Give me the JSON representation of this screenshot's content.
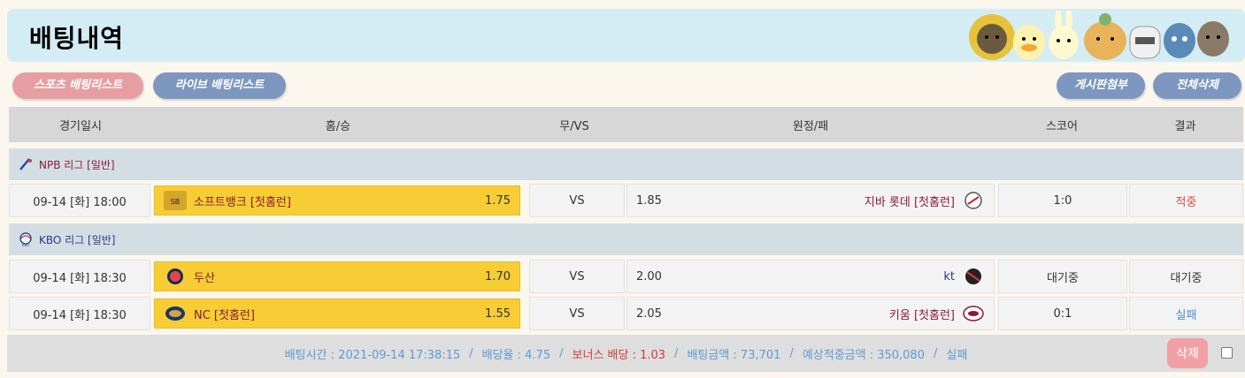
{
  "header": {
    "title": "배팅내역"
  },
  "buttons": {
    "sports_list": "스포츠 배팅리스트",
    "live_list": "라이브 배팅리스트",
    "board_attach": "게시판첨부",
    "delete_all": "전체삭제"
  },
  "table": {
    "columns": [
      "경기일시",
      "홈/승",
      "무/VS",
      "원정/패",
      "스코어",
      "결과"
    ],
    "groups": [
      {
        "league": "NPB 리그 [일반]",
        "league_icon": "npb-logo-icon",
        "rows": [
          {
            "datetime": "09-14 [화] 18:00",
            "home_team": "소프트뱅크 [첫홈런]",
            "home_odd": "1.75",
            "vs": "VS",
            "away_odd": "1.85",
            "away_team": "지바 롯데 [첫홈런]",
            "score": "1:0",
            "result": "적중"
          }
        ]
      },
      {
        "league": "KBO 리그 [일반]",
        "league_icon": "kbo-logo-icon",
        "rows": [
          {
            "datetime": "09-14 [화] 18:30",
            "home_team": "두산",
            "home_odd": "1.70",
            "vs": "VS",
            "away_odd": "2.00",
            "away_team": "kt",
            "score": "대기중",
            "result": "대기중"
          },
          {
            "datetime": "09-14 [화] 18:30",
            "home_team": "NC [첫홈런]",
            "home_odd": "1.55",
            "vs": "VS",
            "away_odd": "2.05",
            "away_team": "키움 [첫홈런]",
            "score": "0:1",
            "result": "실패"
          }
        ]
      }
    ]
  },
  "summary": {
    "bet_time": "배팅시간 : 2021-09-14 17:38:15",
    "odds": "배당율 : 4.75",
    "bonus": "보너스 배당 : 1.03",
    "amount": "배팅금액 : 73,701",
    "expected": "예상적중금액 : 350,080",
    "status": "실패",
    "separator": "/",
    "delete": "삭제"
  },
  "colors": {
    "header_bg": "#d4ecf4",
    "home_highlight": "#f6cd35",
    "pill_pink": "#e79ea3",
    "pill_blue": "#7e97c1",
    "hit": "#e04848",
    "fail": "#4a8fd4"
  }
}
